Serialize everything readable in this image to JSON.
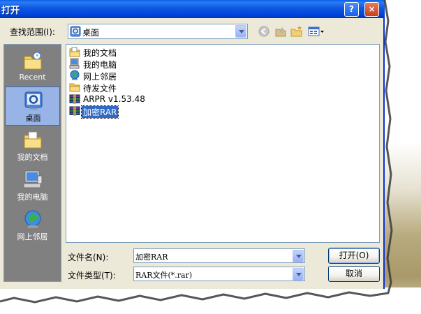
{
  "window": {
    "title": "打开",
    "help_glyph": "?",
    "close_glyph": "×"
  },
  "lookin": {
    "label": "查找范围(I):",
    "value": "桌面"
  },
  "toolbar": {
    "icons": [
      "back-icon",
      "up-folder-icon",
      "new-folder-icon",
      "views-menu-icon"
    ]
  },
  "places": [
    {
      "label": "Recent",
      "icon": "recent-icon"
    },
    {
      "label": "桌面",
      "icon": "desktop-icon"
    },
    {
      "label": "我的文档",
      "icon": "my-documents-icon"
    },
    {
      "label": "我的电脑",
      "icon": "my-computer-icon"
    },
    {
      "label": "网上邻居",
      "icon": "network-icon"
    }
  ],
  "files": [
    {
      "name": "我的文档",
      "icon": "my-documents-icon"
    },
    {
      "name": "我的电脑",
      "icon": "my-computer-icon"
    },
    {
      "name": "网上邻居",
      "icon": "network-icon"
    },
    {
      "name": "待发文件",
      "icon": "folder-icon"
    },
    {
      "name": "ARPR v1.53.48",
      "icon": "rar-archive-icon"
    },
    {
      "name": "加密RAR",
      "icon": "rar-archive-icon",
      "selected": true
    }
  ],
  "filename": {
    "label": "文件名(N):",
    "value": "加密RAR"
  },
  "filetype": {
    "label": "文件类型(T):",
    "value": "RAR文件(*.rar)"
  },
  "buttons": {
    "open": "打开(O)",
    "cancel": "取消"
  },
  "colors": {
    "titlebar": "#0a5fe8",
    "dialog_bg": "#ece9d8",
    "selection": "#316ac5",
    "places_bg": "#808080"
  }
}
